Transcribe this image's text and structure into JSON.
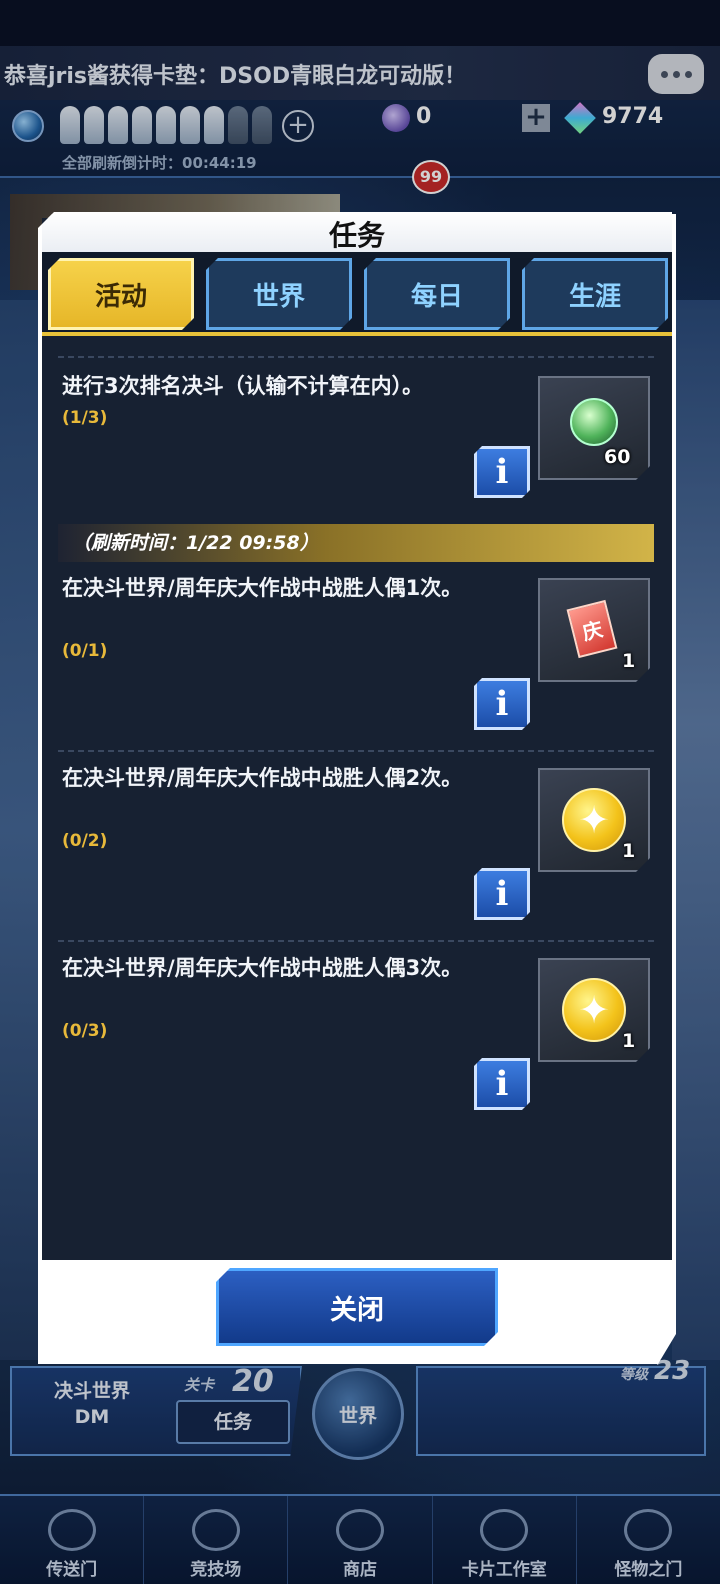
{
  "ticker": {
    "text": "恭喜jris酱获得卡垫：DSOD青眼白龙可动版！"
  },
  "status": {
    "refresh_label": "全部刷新倒计时：00:44:19",
    "orb_count": "0",
    "gem_count": "9774",
    "notification_badge": "99"
  },
  "modal": {
    "title": "任务",
    "tabs": [
      {
        "label": "活动",
        "active": true
      },
      {
        "label": "世界",
        "active": false
      },
      {
        "label": "每日",
        "active": false
      },
      {
        "label": "生涯",
        "active": false
      }
    ],
    "refresh_banner": "（刷新时间：1/22 09:58）",
    "info_label": "i",
    "quests": [
      {
        "text": "进行3次排名决斗（认输不计算在内）。",
        "progress": "(1/3)",
        "reward_qty": "60",
        "reward_icon": "orb-icon"
      },
      {
        "text": "在决斗世界/周年庆大作战中战胜人偶1次。",
        "progress": "(0/1)",
        "reward_qty": "1",
        "reward_icon": "ticket-icon",
        "reward_glyph": "庆"
      },
      {
        "text": "在决斗世界/周年庆大作战中战胜人偶2次。",
        "progress": "(0/2)",
        "reward_qty": "1",
        "reward_icon": "gold-star-icon"
      },
      {
        "text": "在决斗世界/周年庆大作战中战胜人偶3次。",
        "progress": "(0/3)",
        "reward_qty": "1",
        "reward_icon": "gold-star-icon"
      }
    ],
    "close_label": "关闭"
  },
  "hud": {
    "duel_world": "决斗世界 DM",
    "stage_label": "关卡",
    "stage_num": "20",
    "quest_button": "任务",
    "world_button": "世界",
    "level_label": "等级",
    "level_num": "23"
  },
  "nav": [
    {
      "label": "传送门"
    },
    {
      "label": "竞技场"
    },
    {
      "label": "商店"
    },
    {
      "label": "卡片工作室"
    },
    {
      "label": "怪物之门"
    }
  ]
}
